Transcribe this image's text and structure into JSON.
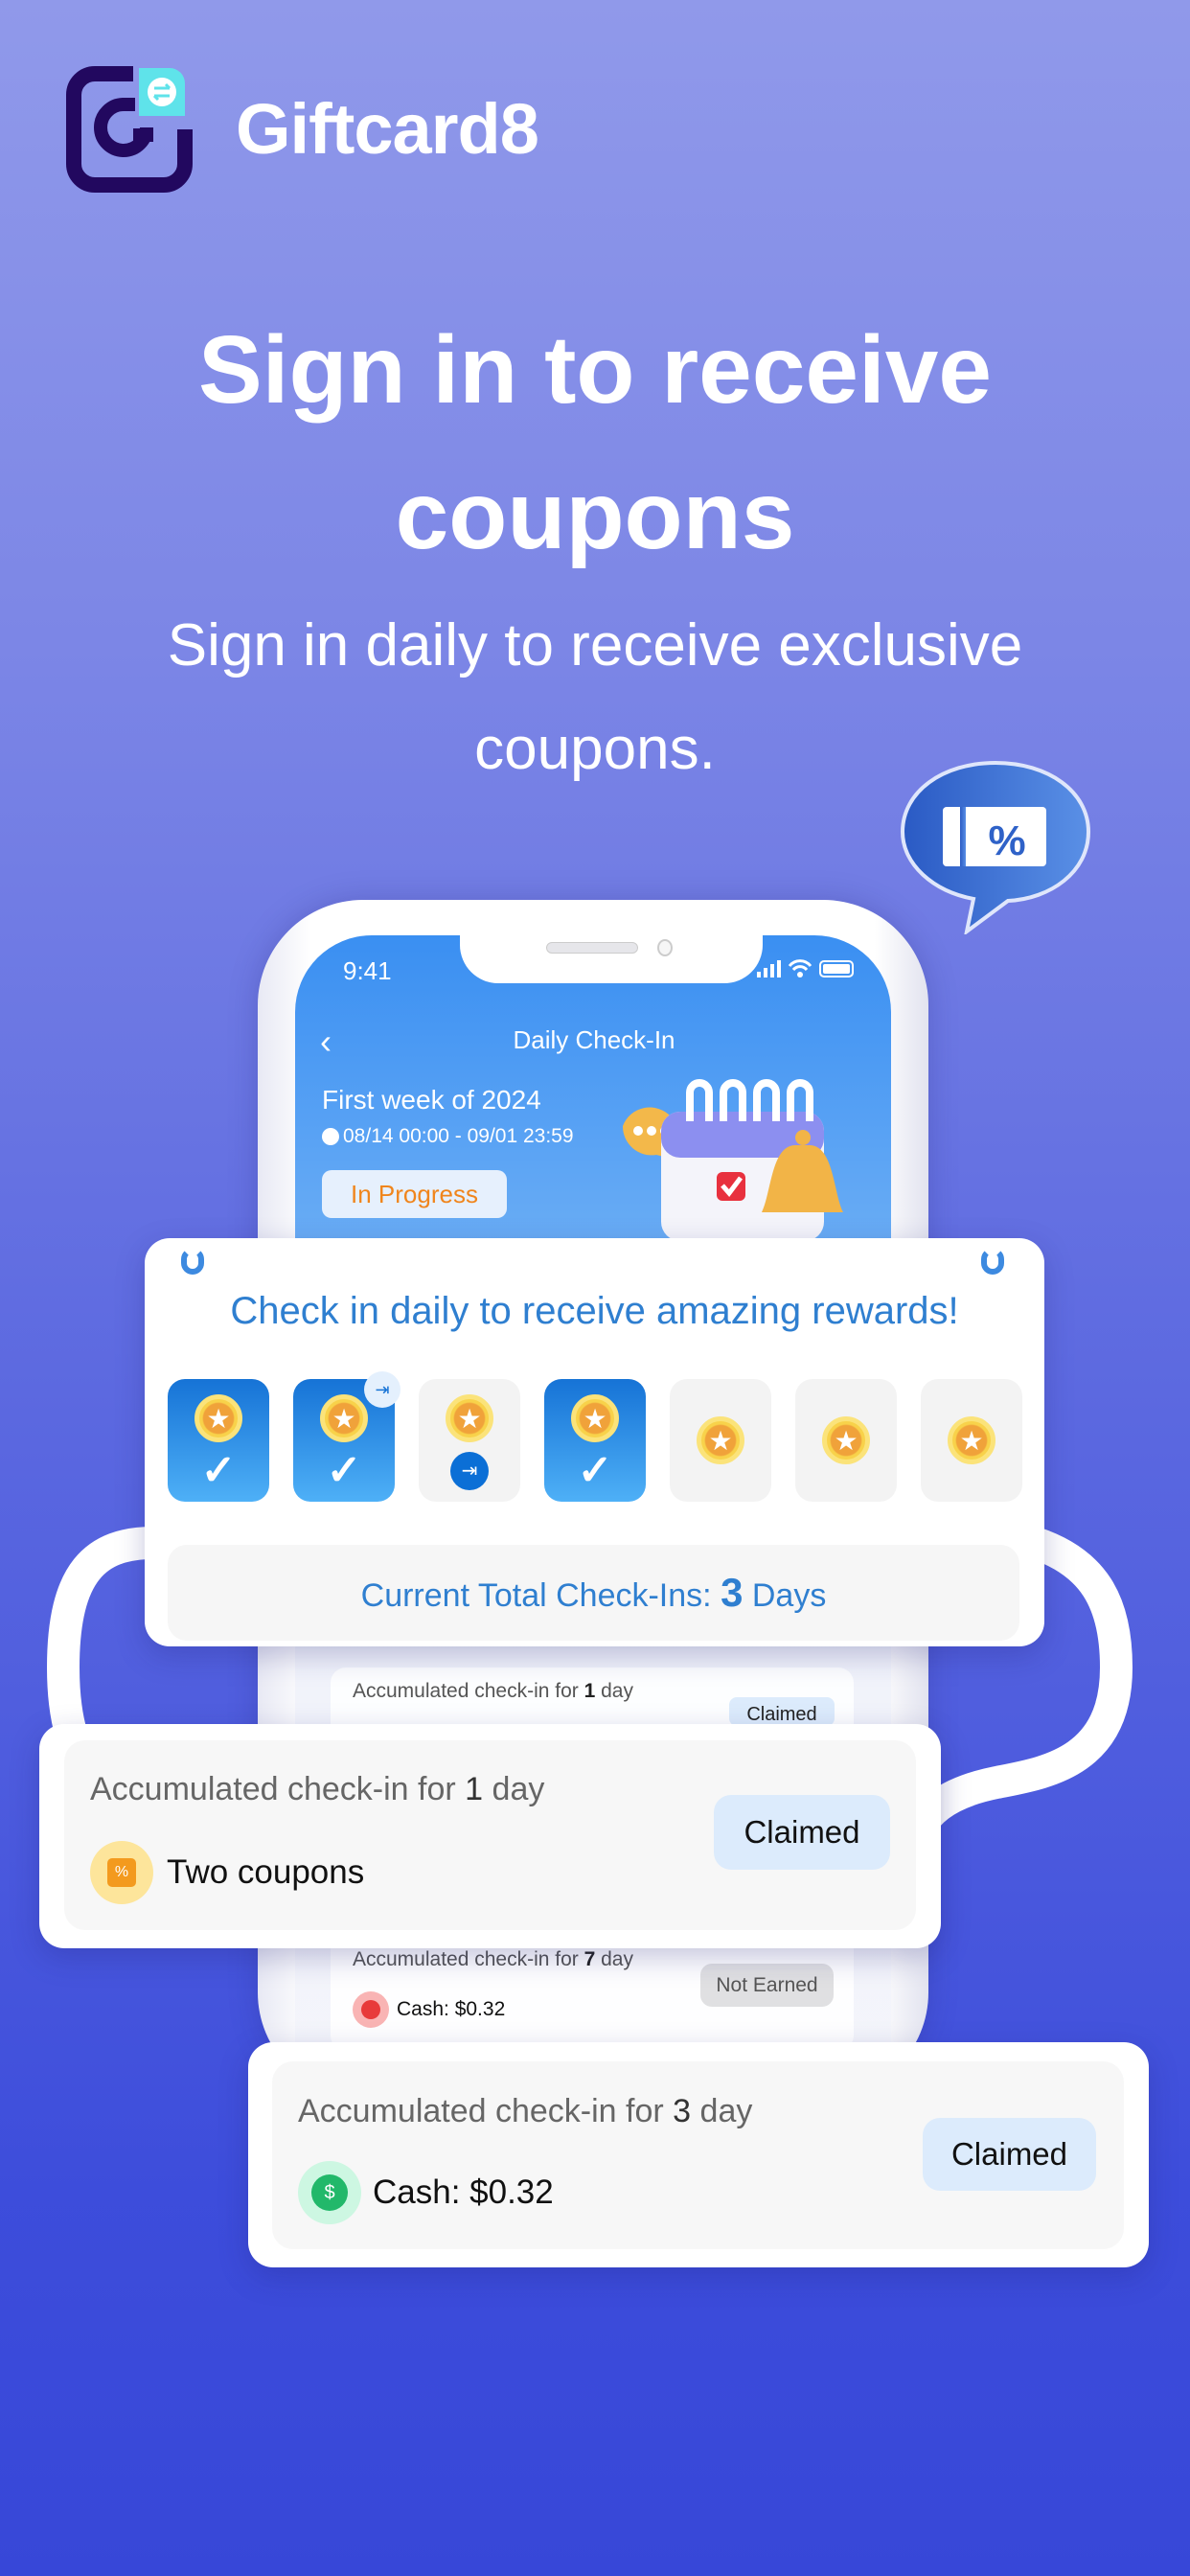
{
  "brand": {
    "name": "Giftcard8"
  },
  "hero": {
    "title_line1": "Sign in to receive",
    "title_line2": "coupons",
    "subtitle_line1": "Sign in daily to receive exclusive",
    "subtitle_line2": "coupons."
  },
  "phone": {
    "status_time": "9:41",
    "header_title": "Daily Check-In",
    "event_title": "First week of 2024",
    "event_dates": "08/14 00:00 - 09/01 23:59",
    "status_button": "In Progress",
    "bg_list": [
      {
        "prefix": "Accumulated check-in for ",
        "days": "1",
        "suffix": " day",
        "button": "Claimed"
      },
      {
        "prefix": "Accumulated check-in for ",
        "days": "7",
        "suffix": " day",
        "reward": "Cash: $0.32",
        "button": "Not Earned"
      }
    ]
  },
  "checkin_card": {
    "title": "Check in daily to receive amazing rewards!",
    "days": [
      {
        "state": "checked"
      },
      {
        "state": "checked",
        "badge": "calendar-makeup-icon"
      },
      {
        "state": "makeup"
      },
      {
        "state": "checked"
      },
      {
        "state": "pending"
      },
      {
        "state": "pending"
      },
      {
        "state": "pending"
      }
    ],
    "total_prefix": "Current Total Check-Ins: ",
    "total_value": "3",
    "total_suffix": " Days"
  },
  "reward_cards": [
    {
      "prefix": "Accumulated check-in for ",
      "days": "1",
      "suffix": " day",
      "reward": "Two coupons",
      "icon": "coupon-icon",
      "button": "Claimed"
    },
    {
      "prefix": "Accumulated check-in for ",
      "days": "3",
      "suffix": " day",
      "reward": "Cash: $0.32",
      "icon": "dollar-coin-icon",
      "button": "Claimed"
    }
  ],
  "colors": {
    "accent": "#2f7fd0",
    "brand_dark": "#22085f",
    "brand_cyan": "#5fe3ea",
    "in_progress": "#f0851c",
    "claimed_bg": "#dcebfc"
  }
}
